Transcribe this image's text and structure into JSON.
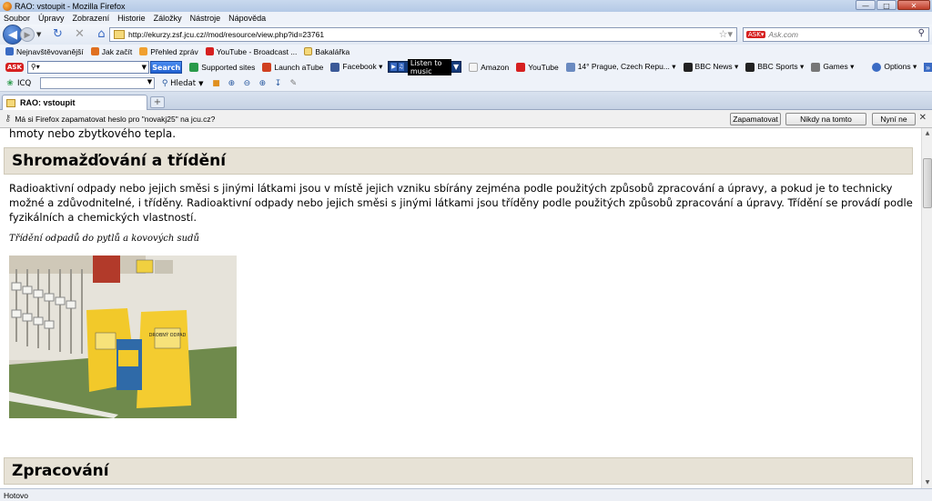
{
  "window": {
    "title": "RAO: vstoupit - Mozilla Firefox"
  },
  "menu": [
    "Soubor",
    "Úpravy",
    "Zobrazení",
    "Historie",
    "Záložky",
    "Nástroje",
    "Nápověda"
  ],
  "nav": {
    "url": "http://ekurzy.zsf.jcu.cz//mod/resource/view.php?id=23761",
    "search_placeholder": "Ask.com"
  },
  "bookmarks": [
    {
      "label": "Nejnavštěvovanější",
      "color": "#3a6bc4"
    },
    {
      "label": "Jak začít",
      "color": "#e07020"
    },
    {
      "label": "Přehled zpráv",
      "color": "#f0a030"
    },
    {
      "label": "YouTube - Broadcast ...",
      "color": "#d62020"
    },
    {
      "label": "Bakalářka",
      "color": "#f5d97a"
    }
  ],
  "ask_toolbar": {
    "badge": "ASK",
    "search_value": "",
    "search_button": "Search",
    "music_label": "Listen to music",
    "items": [
      {
        "label": "Supported sites",
        "color": "#2a9a4a"
      },
      {
        "label": "Launch aTube",
        "color": "#d04020"
      },
      {
        "label": "Facebook ▾",
        "color": "#3b5998"
      },
      {
        "label": "Amazon",
        "color": "#222222"
      },
      {
        "label": "YouTube",
        "color": "#d62020"
      },
      {
        "label": "14° Prague, Czech Repu... ▾",
        "color": "#6a8ac0"
      },
      {
        "label": "BBC News ▾",
        "color": "#222222"
      },
      {
        "label": "BBC Sports ▾",
        "color": "#222222"
      },
      {
        "label": "Games ▾",
        "color": "#555555"
      },
      {
        "label": "Options ▾",
        "color": "#3a6bc4"
      }
    ]
  },
  "icq_toolbar": {
    "label": "ICQ",
    "find_label": "Hledat"
  },
  "tab": {
    "label": "RAO: vstoupit"
  },
  "notification": {
    "message": "Má si Firefox zapamatovat heslo pro \"novakj25\" na jcu.cz?",
    "buttons": [
      "Zapamatovat",
      "Nikdy na tomto serveru",
      "Nyní ne"
    ]
  },
  "content": {
    "fragment": "hmoty nebo zbytkového tepla.",
    "heading1": "Shromažďování a třídění",
    "paragraph": "Radioaktivní odpady nebo jejich směsi s jinými látkami jsou v místě jejich vzniku sbírány zejména podle použitých způsobů zpracování a úpravy, a pokud je to technicky možné a zdůvodnitelné, i tříděny. Radioaktivní odpady nebo jejich směsi s jinými látkami jsou tříděny podle použitých způsobů zpracování a úpravy. Třídění se provádí podle fyzikálních a chemických vlastností.",
    "caption": "Třídění odpadů do pytlů a kovových sudů",
    "photo_bag_label": "DROBNÝ ODPAD",
    "heading2": "Zpracování"
  },
  "status": "Hotovo"
}
